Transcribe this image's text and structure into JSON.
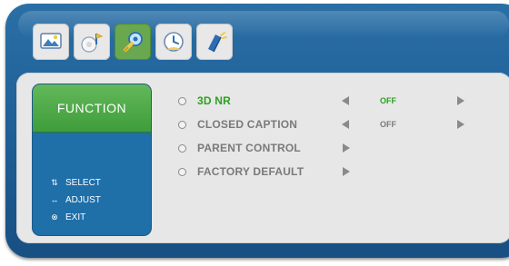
{
  "top_icons": [
    {
      "name": "picture-icon"
    },
    {
      "name": "sound-icon"
    },
    {
      "name": "function-icon",
      "active": true
    },
    {
      "name": "time-icon"
    },
    {
      "name": "channel-icon"
    }
  ],
  "side_panel": {
    "title": "FUNCTION",
    "help": [
      {
        "icon": "updown-arrows-icon",
        "glyph": "⇅",
        "text": "SELECT"
      },
      {
        "icon": "leftright-arrows-icon",
        "glyph": "↔",
        "text": "ADJUST"
      },
      {
        "icon": "exit-icon",
        "glyph": "⊗",
        "text": "EXIT"
      }
    ]
  },
  "menu": {
    "items": [
      {
        "label": "3D NR",
        "value": "OFF",
        "selected": true
      },
      {
        "label": "CLOSED CAPTION",
        "value": "OFF"
      },
      {
        "label": "PARENT CONTROL"
      },
      {
        "label": "FACTORY DEFAULT"
      }
    ]
  },
  "colors": {
    "frame_blue": "#1d5e95",
    "panel_gray": "#e7e7e7",
    "accent_green": "#2aa21f",
    "side_blue": "#1f6fa8"
  }
}
